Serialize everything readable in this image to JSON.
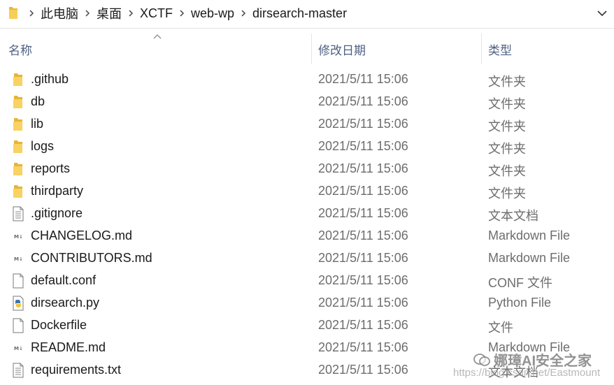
{
  "address_bar": {
    "breadcrumbs": [
      "此电脑",
      "桌面",
      "XCTF",
      "web-wp",
      "dirsearch-master"
    ]
  },
  "columns": {
    "name": "名称",
    "date_modified": "修改日期",
    "type": "类型"
  },
  "files": [
    {
      "name": ".github",
      "date": "2021/5/11 15:06",
      "type": "文件夹",
      "icon": "folder-icon"
    },
    {
      "name": "db",
      "date": "2021/5/11 15:06",
      "type": "文件夹",
      "icon": "folder-icon"
    },
    {
      "name": "lib",
      "date": "2021/5/11 15:06",
      "type": "文件夹",
      "icon": "folder-icon"
    },
    {
      "name": "logs",
      "date": "2021/5/11 15:06",
      "type": "文件夹",
      "icon": "folder-icon"
    },
    {
      "name": "reports",
      "date": "2021/5/11 15:06",
      "type": "文件夹",
      "icon": "folder-icon"
    },
    {
      "name": "thirdparty",
      "date": "2021/5/11 15:06",
      "type": "文件夹",
      "icon": "folder-icon"
    },
    {
      "name": ".gitignore",
      "date": "2021/5/11 15:06",
      "type": "文本文档",
      "icon": "text-document-icon"
    },
    {
      "name": "CHANGELOG.md",
      "date": "2021/5/11 15:06",
      "type": "Markdown File",
      "icon": "markdown-file-icon"
    },
    {
      "name": "CONTRIBUTORS.md",
      "date": "2021/5/11 15:06",
      "type": "Markdown File",
      "icon": "markdown-file-icon"
    },
    {
      "name": "default.conf",
      "date": "2021/5/11 15:06",
      "type": "CONF 文件",
      "icon": "blank-file-icon"
    },
    {
      "name": "dirsearch.py",
      "date": "2021/5/11 15:06",
      "type": "Python File",
      "icon": "python-file-icon"
    },
    {
      "name": "Dockerfile",
      "date": "2021/5/11 15:06",
      "type": "文件",
      "icon": "blank-file-icon"
    },
    {
      "name": "README.md",
      "date": "2021/5/11 15:06",
      "type": "Markdown File",
      "icon": "markdown-file-icon"
    },
    {
      "name": "requirements.txt",
      "date": "2021/5/11 15:06",
      "type": "文本文档",
      "icon": "text-document-icon"
    }
  ],
  "watermark": {
    "main": "娜璋AI安全之家",
    "sub": "https://blog.csdn.net/Eastmount"
  }
}
